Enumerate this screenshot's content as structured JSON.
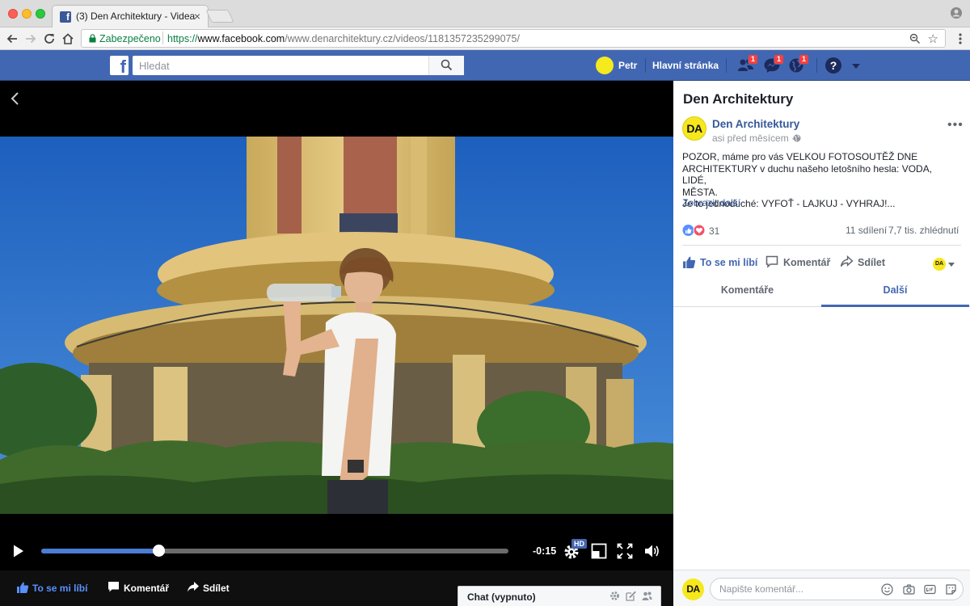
{
  "browser": {
    "tab_title": "(3) Den Architektury - Videa",
    "tab_close": "×",
    "secure_label": "Zabezpečeno",
    "url_scheme": "https://",
    "url_host": "www.facebook.com",
    "url_path": "/www.denarchitektury.cz/videos/1181357235299075/"
  },
  "facebook": {
    "search_placeholder": "Hledat",
    "user_name": "Petr",
    "home_label": "Hlavní stránka",
    "friends_badge": "1",
    "messages_badge": "1",
    "notifications_badge": "1",
    "help_glyph": "?"
  },
  "video": {
    "time_remaining": "-0:15",
    "progress": 0.25,
    "hd_label": "HD",
    "actions": {
      "like": "To se mi líbí",
      "comment": "Komentář",
      "share": "Sdílet"
    }
  },
  "chat": {
    "label": "Chat (vypnuto)"
  },
  "panel": {
    "title": "Den Architektury",
    "page_name": "Den Architektury",
    "page_initials": "DA",
    "post_time": "asi před měsícem ·",
    "post_lines": [
      "POZOR, máme pro vás VELKOU FOTOSOUTĚŽ DNE",
      "ARCHITEKTURY v duchu našeho letošního hesla: VODA, LIDÉ,",
      "MĚSTA.",
      "Je to jednoduché: VYFOŤ - LAJKUJ - VYHRAJ!..."
    ],
    "see_more": "Zobrazit další",
    "reaction_count": "31",
    "shares": "11 sdílení",
    "views": "7,7 tis. zhlédnutí",
    "actions": {
      "like": "To se mi líbí",
      "comment": "Komentář",
      "share": "Sdílet"
    },
    "tabs": [
      "Komentáře",
      "Další"
    ],
    "active_tab": 1,
    "comment_placeholder": "Napište komentář...",
    "more_glyph": "•••"
  },
  "colors": {
    "facebook_blue": "#4267b2",
    "progress_blue": "#4b7cd6",
    "link_blue": "#365899",
    "badge_red": "#fa3e3e",
    "page_yellow": "#f7e81e"
  },
  "icons": [
    "back-icon",
    "forward-icon",
    "reload-icon",
    "home-icon",
    "lock-icon",
    "zoom-icon",
    "star-icon",
    "menu-icon",
    "search-icon",
    "friends-icon",
    "messenger-icon",
    "globe-icon",
    "help-icon",
    "play-icon",
    "settings-icon",
    "theater-icon",
    "fullscreen-icon",
    "volume-icon",
    "like-icon",
    "comment-icon",
    "share-icon"
  ]
}
